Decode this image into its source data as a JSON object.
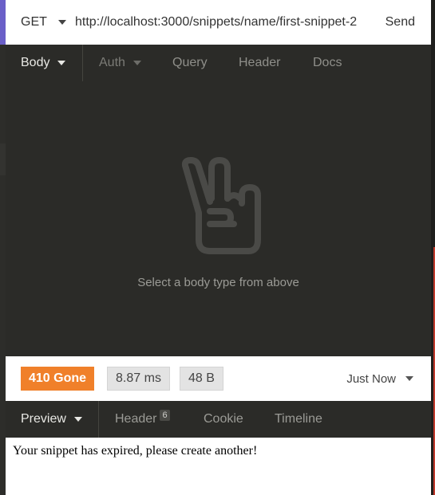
{
  "request": {
    "method": "GET",
    "url": "http://localhost:3000/snippets/name/first-snippet-2",
    "send_label": "Send"
  },
  "request_tabs": {
    "body": "Body",
    "auth": "Auth",
    "query": "Query",
    "header": "Header",
    "docs": "Docs"
  },
  "body_panel": {
    "icon": "peace-hand-icon",
    "hint": "Select a body type from above"
  },
  "response": {
    "status": "410 Gone",
    "time": "8.87 ms",
    "size": "48 B",
    "timestamp": "Just Now",
    "status_color": "#f0802a"
  },
  "response_tabs": {
    "preview": "Preview",
    "header": "Header",
    "header_count": "6",
    "cookie": "Cookie",
    "timeline": "Timeline"
  },
  "preview": {
    "text": "Your snippet has expired, please create another!"
  }
}
